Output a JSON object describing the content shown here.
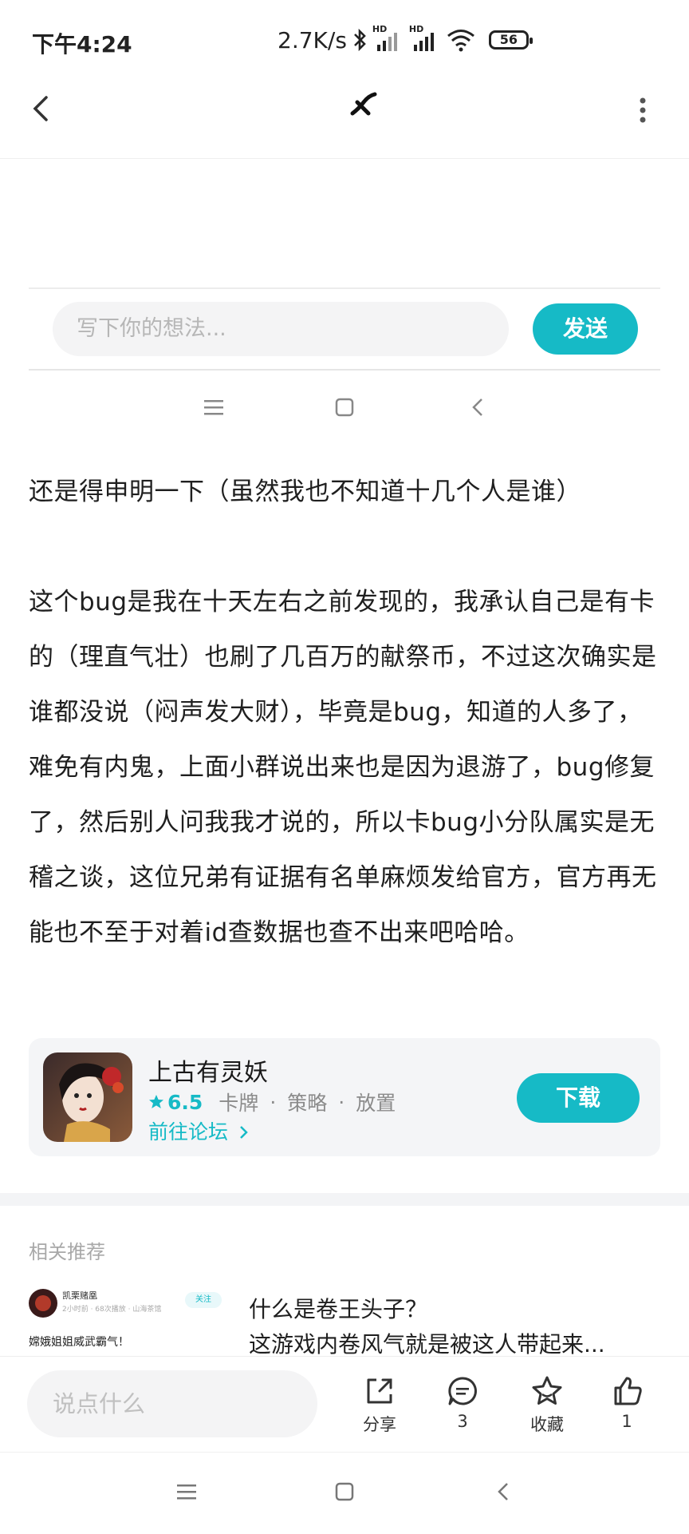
{
  "status_bar": {
    "time": "下午4:24",
    "network_speed": "2.7K/s",
    "hd1": "HD",
    "hd2": "HD",
    "battery": "56"
  },
  "top_nav": {
    "back_icon": "chevron-left-icon",
    "logo_icon": "app-logo-icon",
    "more_icon": "more-vertical-icon"
  },
  "comment_box": {
    "placeholder": "写下你的想法...",
    "send_label": "发送"
  },
  "inner_nav": {
    "menu_icon": "menu-icon",
    "home_icon": "square-icon",
    "back_icon": "chevron-left-icon"
  },
  "article": {
    "paragraph_1": "还是得申明一下（虽然我也不知道十几个人是谁）",
    "paragraph_2": "这个bug是我在十天左右之前发现的，我承认自己是有卡的（理直气壮）也刷了几百万的献祭币，不过这次确实是谁都没说（闷声发大财），毕竟是bug，知道的人多了，难免有内鬼，上面小群说出来也是因为退游了，bug修复了，然后别人问我我才说的，所以卡bug小分队属实是无稽之谈，这位兄弟有证据有名单麻烦发给官方，官方再无能也不至于对着id查数据也查不出来吧哈哈。"
  },
  "game_card": {
    "name": "上古有灵妖",
    "score": "6.5",
    "tags": [
      "卡牌",
      "策略",
      "放置"
    ],
    "forum_link": "前往论坛",
    "download_label": "下载",
    "accent_color": "#16bac6"
  },
  "related": {
    "section_title": "相关推荐",
    "items": [
      {
        "thumb_user": "凯栗赌凰",
        "thumb_meta": "2小时前 · 68次播放 · 山海茶馆",
        "thumb_follow": "关注",
        "thumb_caption": "嫦娥姐姐威武霸气！",
        "title": "什么是卷王头子？",
        "snippet": "这游戏内卷风气就是被这人带起来..."
      }
    ]
  },
  "bottom_bar": {
    "input_placeholder": "说点什么",
    "share_label": "分享",
    "comment_count": "3",
    "favorite_label": "收藏",
    "like_count": "1"
  }
}
